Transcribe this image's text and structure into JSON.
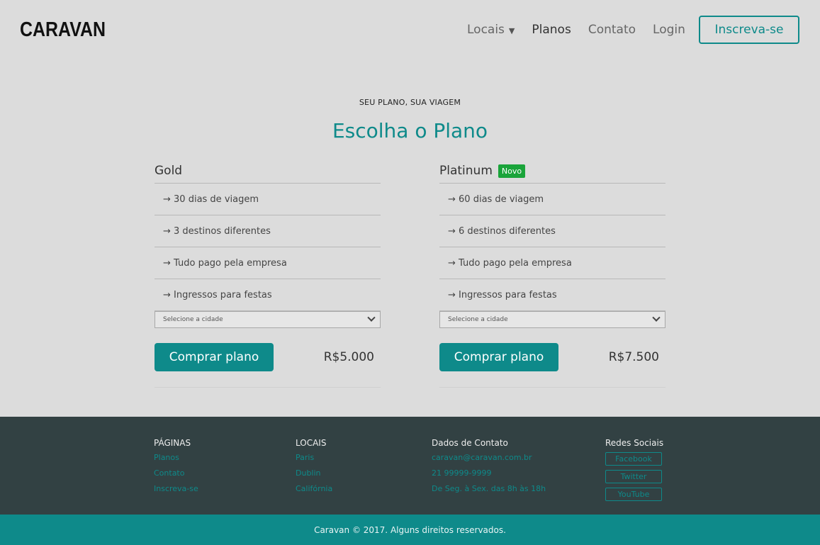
{
  "header": {
    "logo": "CARAVAN",
    "nav": [
      {
        "label": "Locais",
        "caret": "▼"
      },
      {
        "label": "Planos"
      },
      {
        "label": "Contato"
      },
      {
        "label": "Login"
      }
    ],
    "signup_label": "Inscreva-se"
  },
  "hero": {
    "eyebrow": "SEU PLANO, SUA VIAGEM",
    "title": "Escolha o Plano"
  },
  "plans": [
    {
      "name": "Gold",
      "badge": "",
      "features": [
        "→ 30 dias de viagem",
        "→ 3 destinos diferentes",
        "→ Tudo pago pela empresa",
        "→ Ingressos para festas"
      ],
      "select_placeholder": "Selecione a cidade",
      "buy_label": "Comprar plano",
      "price": "R$5.000"
    },
    {
      "name": "Platinum",
      "badge": "Novo",
      "features": [
        "→ 60 dias de viagem",
        "→ 6 destinos diferentes",
        "→ Tudo pago pela empresa",
        "→ Ingressos para festas"
      ],
      "select_placeholder": "Selecione a cidade",
      "buy_label": "Comprar plano",
      "price": "R$7.500"
    }
  ],
  "footer": {
    "pages": {
      "title": "PÁGINAS",
      "links": [
        "Planos",
        "Contato",
        "Inscreva-se"
      ]
    },
    "locations": {
      "title": "LOCAIS",
      "links": [
        "Paris",
        "Dublin",
        "Califórnia"
      ]
    },
    "contact": {
      "title": "Dados de Contato",
      "lines": [
        "caravan@caravan.com.br",
        "21 99999-9999",
        "De Seg. à Sex. das 8h às 18h"
      ]
    },
    "social": {
      "title": "Redes Sociais",
      "links": [
        "Facebook",
        "Twitter",
        "YouTube"
      ]
    },
    "copyright": "Caravan © 2017. Alguns direitos reservados."
  },
  "colors": {
    "accent": "#0e8a8a",
    "badge": "#1aa43a",
    "footer_bg": "#324143",
    "page_bg": "#dcdcdc"
  }
}
